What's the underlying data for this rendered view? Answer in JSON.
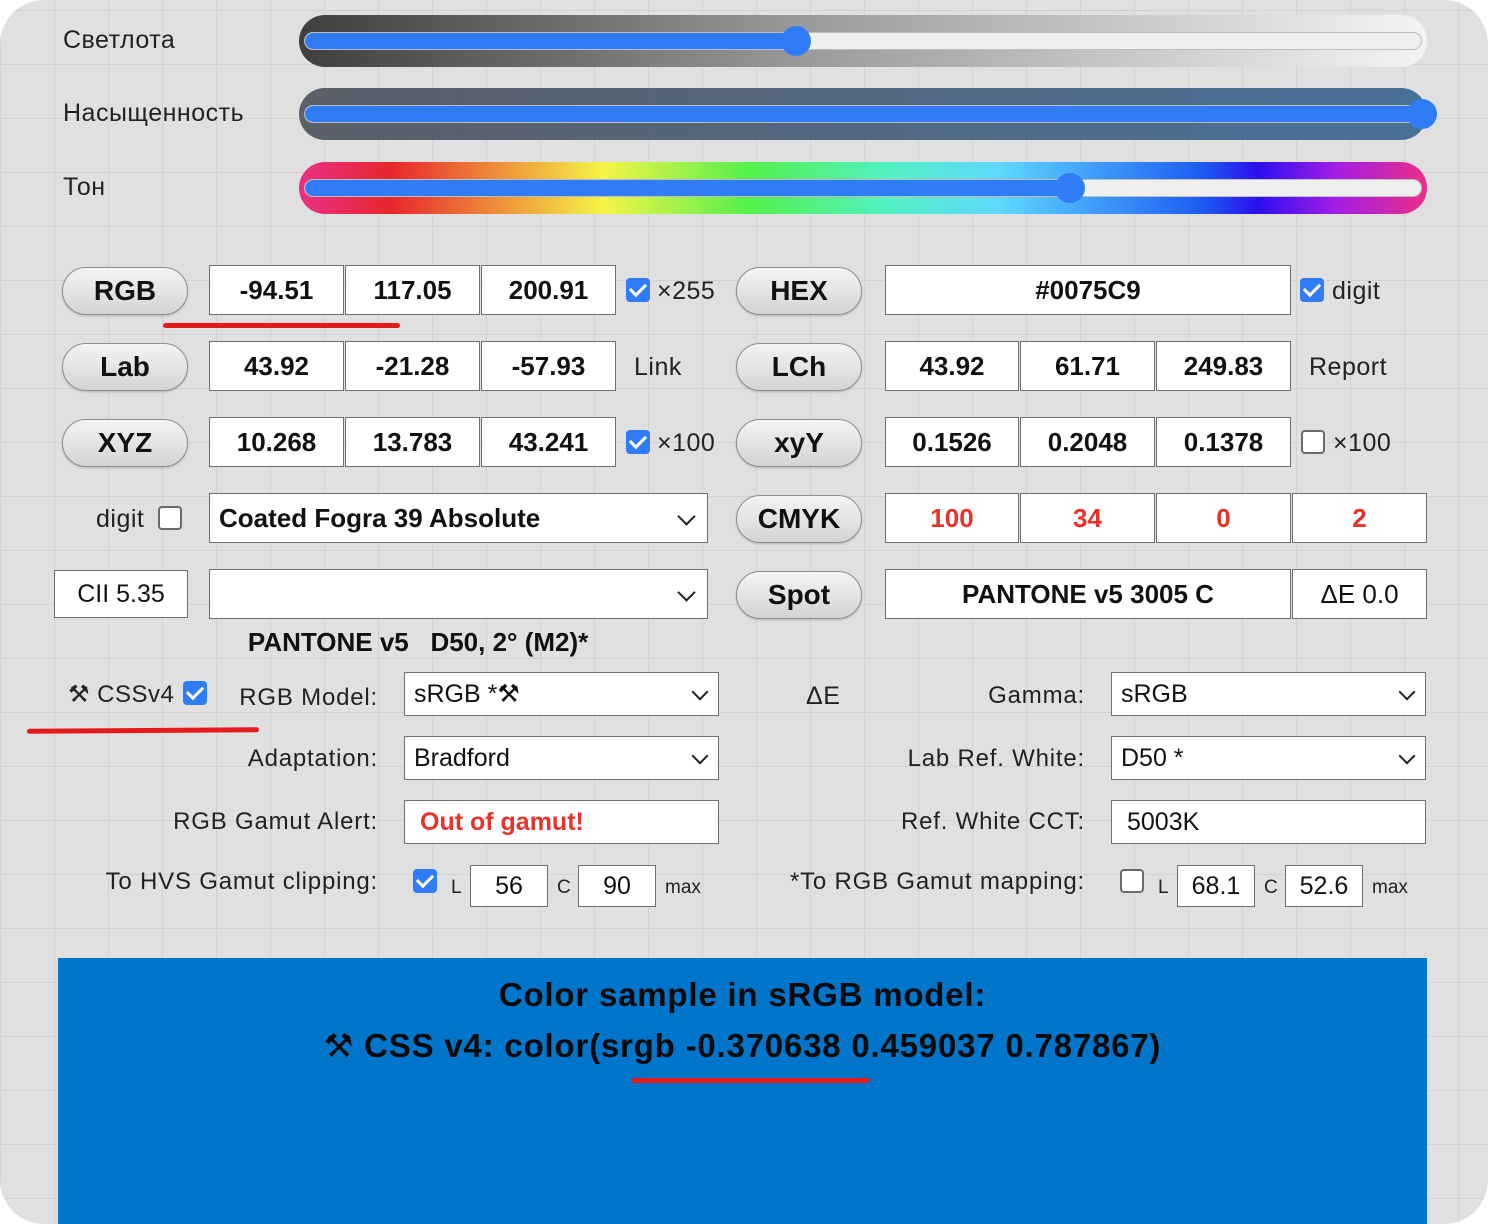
{
  "sliders": {
    "lightness": {
      "label": "Светлота",
      "value": 0.44
    },
    "saturation": {
      "label": "Насыщенность",
      "value": 1.0
    },
    "hue": {
      "label": "Тон",
      "value": 0.685
    }
  },
  "rows": {
    "rgb": {
      "button": "RGB",
      "values": [
        "-94.51",
        "117.05",
        "200.91"
      ],
      "checked": true,
      "suffix": "×255"
    },
    "hex": {
      "button": "HEX",
      "value": "#0075C9",
      "checked": true,
      "suffix": "digit"
    },
    "lab": {
      "button": "Lab",
      "values": [
        "43.92",
        "-21.28",
        "-57.93"
      ],
      "link": "Link"
    },
    "lch": {
      "button": "LCh",
      "values": [
        "43.92",
        "61.71",
        "249.83"
      ],
      "report": "Report"
    },
    "xyz": {
      "button": "XYZ",
      "values": [
        "10.268",
        "13.783",
        "43.241"
      ],
      "checked": true,
      "suffix": "×100"
    },
    "xyy": {
      "button": "xyY",
      "values": [
        "0.1526",
        "0.2048",
        "0.1378"
      ],
      "checked": false,
      "suffix": "×100"
    },
    "cmyk": {
      "digit_label": "digit",
      "digit_checked": false,
      "profile": "Coated Fogra 39 Absolute",
      "button": "CMYK",
      "values": [
        "100",
        "34",
        "0",
        "2"
      ]
    },
    "spot": {
      "cii": "CII 5.35",
      "library": "PANTONE v5   D50, 2° (M2)*",
      "button": "Spot",
      "name": "PANTONE v5 3005 C",
      "delta": "ΔE 0.0"
    }
  },
  "settings": {
    "cssv4_label": "⚒ CSSv4",
    "cssv4_checked": true,
    "rgb_model_label": "RGB Model:",
    "rgb_model_value": "sRGB *⚒",
    "delta_e_label": "ΔE",
    "gamma_label": "Gamma:",
    "gamma_value": "sRGB",
    "adaptation_label": "Adaptation:",
    "adaptation_value": "Bradford",
    "lab_ref_white_label": "Lab Ref. White:",
    "lab_ref_white_value": "D50 *",
    "gamut_alert_label": "RGB Gamut Alert:",
    "gamut_alert_value": "Out of gamut!",
    "ref_white_cct_label": "Ref. White CCT:",
    "ref_white_cct_value": "5003K",
    "hvs_label": "To HVS Gamut clipping:",
    "hvs_checked": true,
    "hvs_l": "56",
    "hvs_c": "90",
    "rgb_mapping_label": "*To RGB Gamut mapping:",
    "rgb_mapping_checked": false,
    "map_l": "68.1",
    "map_c": "52.6",
    "l_letter": "L",
    "c_letter": "C",
    "max_label": "max"
  },
  "sample": {
    "color": "#0075C9",
    "line1": "Color sample in sRGB model:",
    "line2": "⚒ CSS v4: color(srgb -0.370638 0.459037 0.787867)"
  },
  "colors": {
    "accent": "#2f7cf6",
    "alert": "#e8322a",
    "annotation": "#e31b1b"
  }
}
